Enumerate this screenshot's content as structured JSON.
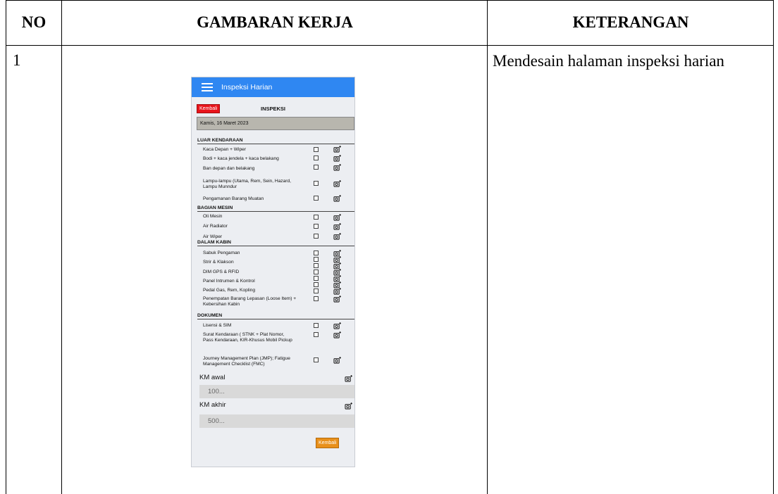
{
  "table": {
    "header_no": "NO",
    "header_gambaran": "GAMBARAN KERJA",
    "header_keterangan": "KETERANGAN",
    "row_no": "1",
    "row_keterangan": "Mendesain halaman inspeksi harian"
  },
  "app": {
    "bar_title": "Inspeksi Harian",
    "back_label": "Kembali",
    "page_title": "INSPEKSI",
    "date": "Kamis, 16 Maret 2023",
    "sections": [
      {
        "title": "LUAR KENDARAAN",
        "items": [
          "Kaca Depan + Wiper",
          "Bodi + kaca jendela + kaca belakang",
          "Ban depan dan belakang",
          "Lampu-lampu (Utama, Rem, Sein, Hazard, Lampu Munndur",
          "Pengamanan Barang Muatan"
        ]
      },
      {
        "title": "BAGIAN MESIN",
        "items": [
          "Oli Mesin",
          "Air Radiator",
          "Air Wiper"
        ]
      },
      {
        "title": "DALAM KABIN",
        "items": [
          "Sabuk Pengaman",
          "Strir & Klakson",
          "DIM GPS & RFID",
          "Panel Intrumen & Kontrol",
          "Pedal Gas, Rem, Kopling",
          "Penempatan Barang Lepasan (Loose Item) + Kebersihan Kabin"
        ]
      },
      {
        "title": "DOKUMEN",
        "items": [
          "Lisensi & SIM",
          "Surat Kendaraan ( STNK + Plat Nomor, Pass Kendaraan, KIR-Khusus Mobil Pickup",
          "Journey Management Plan (JMP); Fatigue Management Checklist (FMC)"
        ]
      }
    ],
    "km_awal_label": "KM awal",
    "km_awal_placeholder": "100...",
    "km_akhir_label": "KM akhir",
    "km_akhir_placeholder": "500...",
    "bottom_button": "Kembali"
  }
}
